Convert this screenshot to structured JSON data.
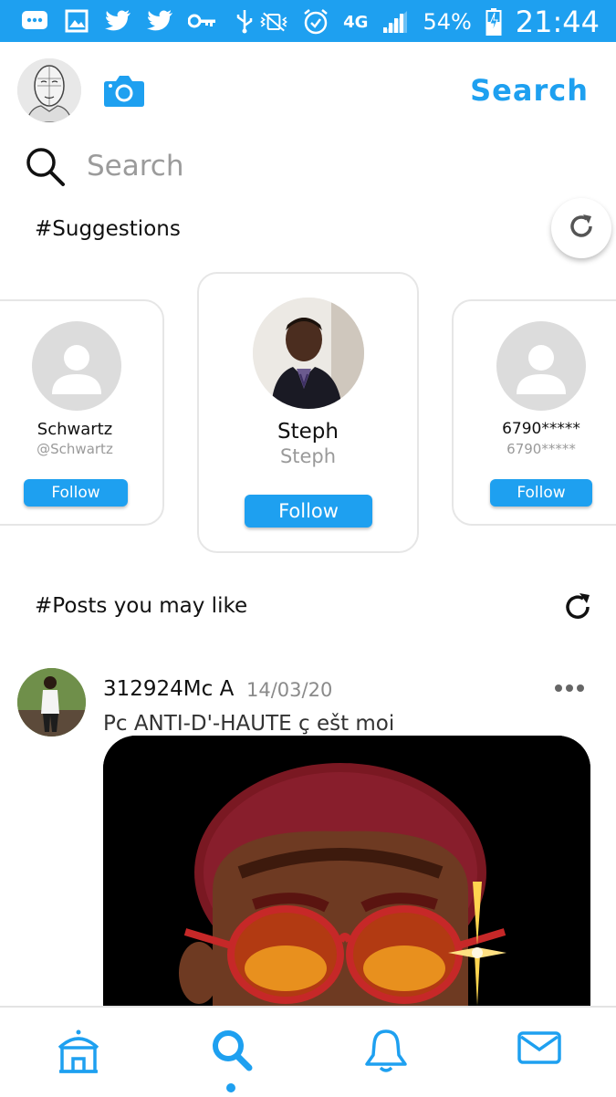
{
  "status_bar": {
    "icons": [
      "message-icon",
      "gallery-icon",
      "twitter-icon",
      "twitter-icon",
      "key-icon",
      "usb-icon",
      "vibrate-icon",
      "alarm-icon",
      "network-4g-icon",
      "signal-icon",
      "battery-charging-icon"
    ],
    "network": "4G",
    "battery": "54%",
    "time": "21:44"
  },
  "header": {
    "search_link": "Search"
  },
  "search": {
    "placeholder": "Search"
  },
  "suggestions": {
    "title": "#Suggestions",
    "cards": [
      {
        "name": "Schwartz",
        "handle": "@Schwartz",
        "follow": "Follow",
        "avatar": "default-avatar-icon"
      },
      {
        "name": "Steph",
        "handle": "Steph",
        "follow": "Follow",
        "avatar": "photo"
      },
      {
        "name": "6790*****",
        "handle": "6790*****",
        "follow": "Follow",
        "avatar": "default-avatar-icon"
      }
    ]
  },
  "posts": {
    "title": "#Posts you may like",
    "items": [
      {
        "user": "312924Mc A",
        "date": "14/03/20",
        "text": "Pc ANTI-D'-HAUTE ç ešt moi"
      }
    ]
  },
  "bottom_nav": {
    "items": [
      "home-icon",
      "search-icon",
      "bell-icon",
      "mail-icon"
    ],
    "active": "search-icon"
  },
  "colors": {
    "accent": "#1ea0f0",
    "status_bar": "#1ea0f0",
    "card_border": "#e6e6e6",
    "placeholder_avatar": "#dcdcdc"
  }
}
